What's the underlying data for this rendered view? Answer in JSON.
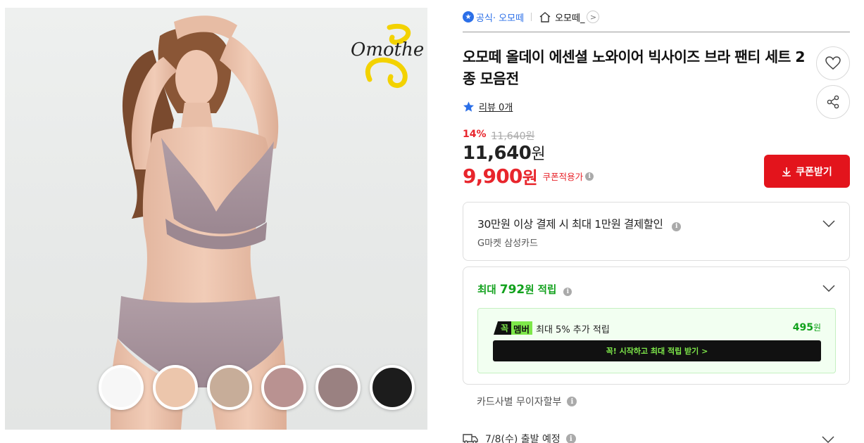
{
  "product_image": {
    "logo_text": "Omothe",
    "swatches": [
      {
        "name": "white",
        "color": "#f7f7f7"
      },
      {
        "name": "beige",
        "color": "#ecc6ac"
      },
      {
        "name": "taupe",
        "color": "#c7ad99"
      },
      {
        "name": "rose",
        "color": "#b99291"
      },
      {
        "name": "mauve",
        "color": "#9a8181"
      },
      {
        "name": "black",
        "color": "#1c1c1c"
      }
    ]
  },
  "breadcrumb": {
    "official_label": "공식",
    "official_store": "· 오모떼",
    "store_name": "오모떼_",
    "arrow": ">"
  },
  "product": {
    "title": "오모떼 올데이 에센셜 노와이어 빅사이즈 브라 팬티 세트 2종 모음전",
    "review_label": "리뷰 0개"
  },
  "pricing": {
    "discount_pct": "14%",
    "original_price": "11,640원",
    "price_value": "11,640",
    "price_unit": "원",
    "coupon_price_value": "9,900",
    "coupon_price_unit": "원",
    "coupon_label": "쿠폰적용가",
    "coupon_button": "쿠폰받기"
  },
  "card_benefit": {
    "headline": "30만원 이상 결제 시 최대 1만원 결제할인",
    "sub": "G마켓 삼성카드"
  },
  "points": {
    "prefix": "최대 ",
    "amount": "792",
    "suffix": "원 적립",
    "member_badge_a": "꼭",
    "member_badge_b": "멤버",
    "member_text": "최대 5% 추가 적립",
    "member_amount": "495",
    "member_unit": "원",
    "member_button": "꼭! 시작하고 최대 적립 받기  >"
  },
  "installment": {
    "label": "카드사별 무이자할부"
  },
  "shipping": {
    "label": "7/8(수) 출발 예정"
  },
  "colors": {
    "accent_red": "#e3141c",
    "accent_green": "#11a11c",
    "official_blue": "#2b6fe8"
  }
}
